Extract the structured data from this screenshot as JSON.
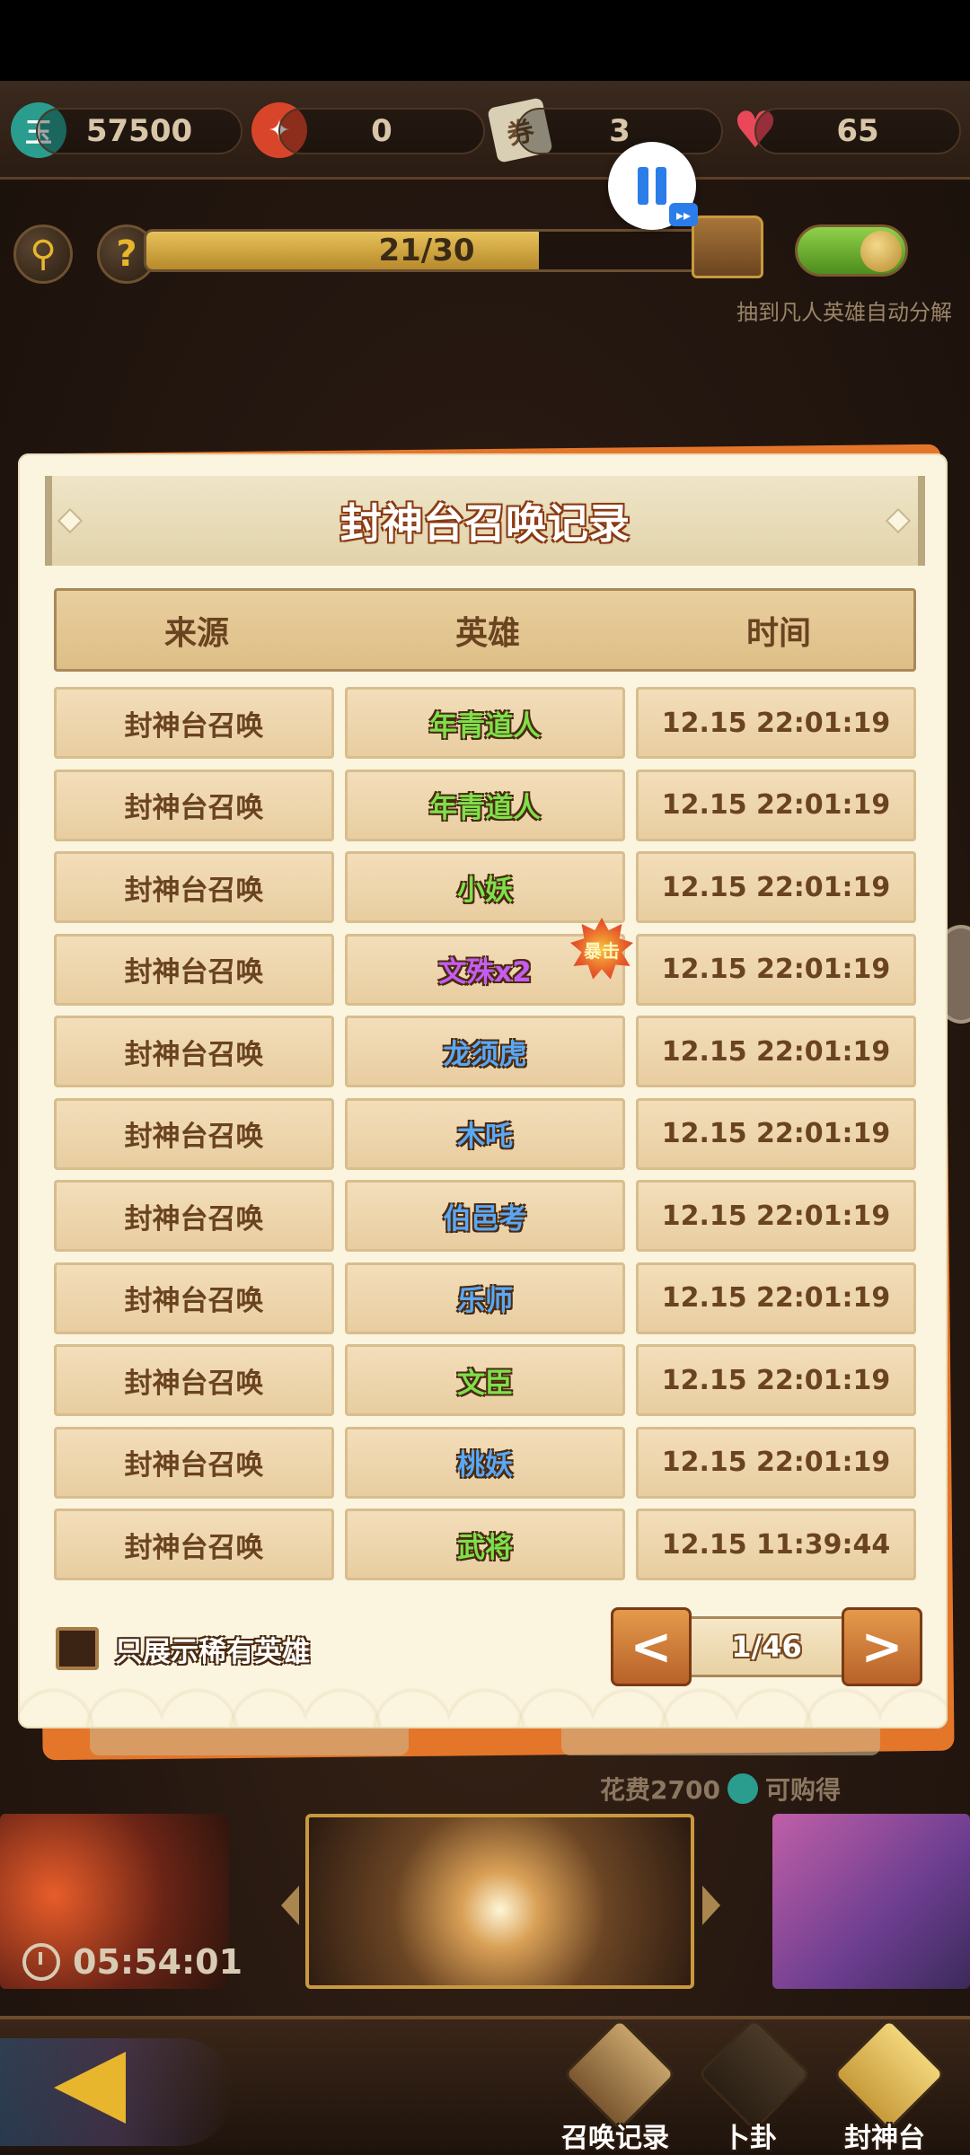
{
  "resources": {
    "coins": "57500",
    "tickets": "0",
    "scrolls": "3",
    "hearts": "65",
    "coin_icon_char": "玉",
    "scroll_icon_char": "券"
  },
  "progress": {
    "text": "21/30",
    "fraction": 0.7
  },
  "auto_decompose_text": "抽到凡人英雄自动分解",
  "modal": {
    "title": "封神台召唤记录",
    "headers": [
      "来源",
      "英雄",
      "时间"
    ],
    "rows": [
      {
        "source": "封神台召唤",
        "hero": "年青道人",
        "time": "12.15 22:01:19",
        "color": "#7ee04a"
      },
      {
        "source": "封神台召唤",
        "hero": "年青道人",
        "time": "12.15 22:01:19",
        "color": "#7ee04a"
      },
      {
        "source": "封神台召唤",
        "hero": "小妖",
        "time": "12.15 22:01:19",
        "color": "#7ee04a"
      },
      {
        "source": "封神台召唤",
        "hero": "文殊x2",
        "time": "12.15 22:01:19",
        "color": "#c65cf2"
      },
      {
        "source": "封神台召唤",
        "hero": "龙须虎",
        "time": "12.15 22:01:19",
        "color": "#5aa8f5"
      },
      {
        "source": "封神台召唤",
        "hero": "木吒",
        "time": "12.15 22:01:19",
        "color": "#5aa8f5"
      },
      {
        "source": "封神台召唤",
        "hero": "伯邑考",
        "time": "12.15 22:01:19",
        "color": "#5aa8f5"
      },
      {
        "source": "封神台召唤",
        "hero": "乐师",
        "time": "12.15 22:01:19",
        "color": "#5aa8f5"
      },
      {
        "source": "封神台召唤",
        "hero": "文臣",
        "time": "12.15 22:01:19",
        "color": "#7ee04a"
      },
      {
        "source": "封神台召唤",
        "hero": "桃妖",
        "time": "12.15 22:01:19",
        "color": "#5aa8f5"
      },
      {
        "source": "封神台召唤",
        "hero": "武将",
        "time": "12.15 11:39:44",
        "color": "#7ee04a"
      }
    ],
    "crit_badge": "暴击",
    "rare_only_label": "只展示稀有英雄",
    "pager": {
      "prev": "<",
      "page": "1/46",
      "next": ">"
    }
  },
  "cost": {
    "prefix": "花费2700",
    "suffix": "可购得"
  },
  "timer": "05:54:01",
  "bottom_nav": [
    {
      "label": "召唤记录"
    },
    {
      "label": "卜卦"
    },
    {
      "label": "封神台"
    }
  ],
  "colors": {
    "accent_orange": "#e4762a",
    "panel_bg": "#fbf4df",
    "green_rarity": "#7ee04a",
    "blue_rarity": "#5aa8f5",
    "purple_rarity": "#c65cf2"
  },
  "icons": {
    "search": "search-icon",
    "help": "help-icon",
    "pause": "pause-icon",
    "chest": "chest-icon",
    "clock": "clock-icon"
  }
}
